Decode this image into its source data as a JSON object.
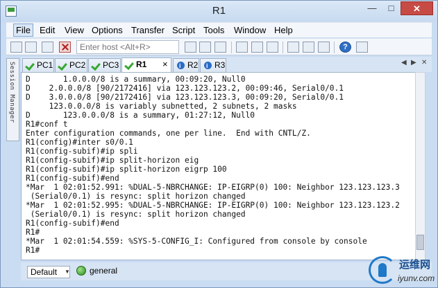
{
  "window": {
    "title": "R1",
    "minimize_glyph": "—",
    "maximize_glyph": "□",
    "close_glyph": "✕"
  },
  "menu": [
    "File",
    "Edit",
    "View",
    "Options",
    "Transfer",
    "Script",
    "Tools",
    "Window",
    "Help"
  ],
  "toolbar": {
    "host_placeholder": "Enter host <Alt+R>"
  },
  "session_manager": {
    "label": "Session Manager"
  },
  "tabs": [
    {
      "label": "PC1",
      "status": "connected"
    },
    {
      "label": "PC2",
      "status": "connected"
    },
    {
      "label": "PC3",
      "status": "connected"
    },
    {
      "label": "R1",
      "status": "connected",
      "active": true,
      "close_glyph": "×"
    },
    {
      "label": "R2",
      "status": "info"
    },
    {
      "label": "R3",
      "status": "info"
    }
  ],
  "tab_nav": {
    "left": "◀",
    "right": "▶",
    "pin": "✕"
  },
  "terminal": {
    "lines": [
      "D       1.0.0.0/8 is a summary, 00:09:20, Null0",
      "D    2.0.0.0/8 [90/2172416] via 123.123.123.2, 00:09:46, Serial0/0.1",
      "D    3.0.0.0/8 [90/2172416] via 123.123.123.3, 00:09:20, Serial0/0.1",
      "     123.0.0.0/8 is variably subnetted, 2 subnets, 2 masks",
      "D       123.0.0.0/8 is a summary, 01:27:12, Null0",
      "R1#conf t",
      "Enter configuration commands, one per line.  End with CNTL/Z.",
      "R1(config)#inter s0/0.1",
      "R1(config-subif)#ip spli",
      "R1(config-subif)#ip split-horizon eig",
      "R1(config-subif)#ip split-horizon eigrp 100",
      "R1(config-subif)#end",
      "*Mar  1 02:01:52.991: %DUAL-5-NBRCHANGE: IP-EIGRP(0) 100: Neighbor 123.123.123.3",
      " (Serial0/0.1) is resync: split horizon changed",
      "*Mar  1 02:01:52.995: %DUAL-5-NBRCHANGE: IP-EIGRP(0) 100: Neighbor 123.123.123.2",
      " (Serial0/0.1) is resync: split horizon changed",
      "R1(config-subif)#end",
      "R1#",
      "*Mar  1 02:01:54.559: %SYS-5-CONFIG_I: Configured from console by console",
      "R1#"
    ]
  },
  "statusbar": {
    "dropdown_value": "Default",
    "dropdown_arrow": "▼",
    "profile": "general"
  },
  "watermark": {
    "chinese_text": "运维网",
    "url": "iyunv.com"
  },
  "colors": {
    "close_button": "#c74b45",
    "connected_check": "#36a82f",
    "info_badge": "#2b6cc7",
    "watermark_blue": "#1f78c8"
  }
}
